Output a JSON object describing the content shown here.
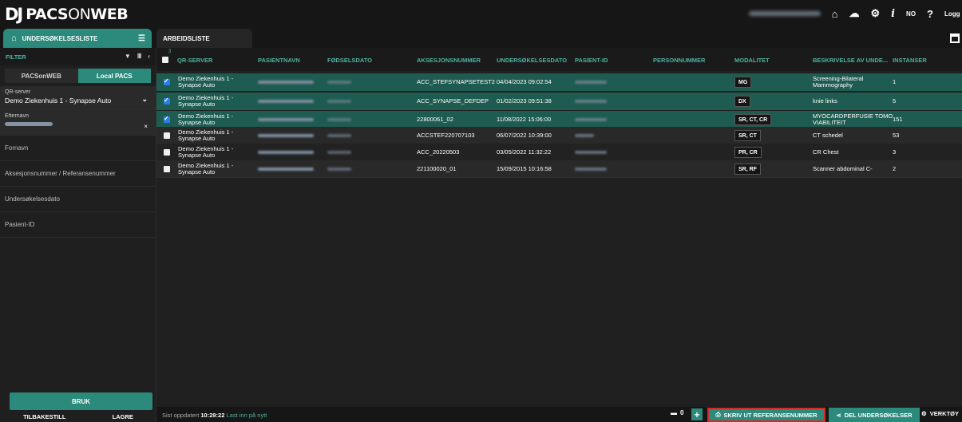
{
  "app": {
    "logo_mark": "DJ",
    "logo_part1": "PACS",
    "logo_part2": "ON",
    "logo_part3": "WEB"
  },
  "topbar": {
    "language": "NO",
    "help": "?",
    "info": "i",
    "logout": "Logg ut"
  },
  "tabs": {
    "active_label": "UNDERSØKELSESLISTE",
    "work_label": "ARBEIDSLISTE"
  },
  "sidebar": {
    "filter_title": "FILTER",
    "source_tabs": [
      "PACSonWEB",
      "Local PACS"
    ],
    "qr_label": "QR-server",
    "qr_value": "Demo Ziekenhuis 1 - Synapse Auto",
    "etternavn_label": "Etternavn",
    "fields": [
      "Fornavn",
      "Aksesjonsnummer / Referansenummer",
      "Undersøkelsesdato",
      "Pasient-ID"
    ],
    "apply_button": "BRUK",
    "reset_button": "TILBAKESTILL",
    "save_button": "LAGRE"
  },
  "table": {
    "selected_count": "3",
    "columns": [
      "QR-SERVER",
      "PASIENTNAVN",
      "FØDSELSDATO",
      "AKSESJONSNUMMER",
      "UNDERSØKELSESDATO",
      "PASIENT-ID",
      "PERSONNUMMER",
      "MODALITET",
      "BESKRIVELSE AV UNDE...",
      "INSTANSER"
    ],
    "rows": [
      {
        "checked": true,
        "server1": "Demo Ziekenhuis 1 -",
        "server2": "Synapse Auto",
        "accession": "ACC_STEFSYNAPSETEST2",
        "date": "04/04/2023 09:02:54",
        "modality": "MG",
        "desc1": "Screening-Bilateral",
        "desc2": "Mammography",
        "instances": "1"
      },
      {
        "checked": true,
        "server1": "Demo Ziekenhuis 1 -",
        "server2": "Synapse Auto",
        "accession": "ACC_SYNAPSE_DEFDEP",
        "date": "01/02/2023 09:51:38",
        "modality": "DX",
        "desc1": "knie links",
        "desc2": "",
        "instances": "5"
      },
      {
        "checked": true,
        "server1": "Demo Ziekenhuis 1 -",
        "server2": "Synapse Auto",
        "accession": "22800061_02",
        "date": "11/08/2022 15:06:00",
        "modality": "SR, CT, CR",
        "desc1": "MYOCARDPERFUSIE TOMO",
        "desc2": "VIABILITEIT",
        "instances": "151"
      },
      {
        "checked": false,
        "server1": "Demo Ziekenhuis 1 -",
        "server2": "Synapse Auto",
        "accession": "ACCSTEF220707103",
        "date": "06/07/2022 10:39:00",
        "modality": "SR, CT",
        "desc1": "CT schedel",
        "desc2": "",
        "instances": "53"
      },
      {
        "checked": false,
        "server1": "Demo Ziekenhuis 1 -",
        "server2": "Synapse Auto",
        "accession": "ACC_20220503",
        "date": "03/05/2022 11:32:22",
        "modality": "PR, CR",
        "desc1": "CR Chest",
        "desc2": "",
        "instances": "3"
      },
      {
        "checked": false,
        "server1": "Demo Ziekenhuis 1 -",
        "server2": "Synapse Auto",
        "accession": "221100020_01",
        "date": "15/09/2015 10:16:58",
        "modality": "SR, RF",
        "desc1": "Scanner abdominal C-",
        "desc2": "",
        "instances": "2"
      }
    ]
  },
  "bottombar": {
    "status_prefix": "Sist oppdatert",
    "status_time": "10:29:22",
    "status_link": "Last inn på nytt",
    "folder_count": "0",
    "plus": "+",
    "print_label": "SKRIV UT REFERANSENUMMER",
    "share_label": "DEL UNDERSØKELSER",
    "tools_label": "VERKTØY"
  },
  "colors": {
    "accent": "#2b8a7b",
    "header_text": "#4fb2a2",
    "selected_row": "#1e5b50",
    "highlight_border": "#d02a2a"
  }
}
